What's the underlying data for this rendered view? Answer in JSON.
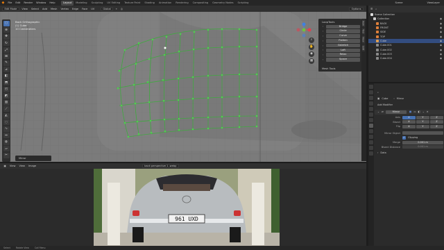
{
  "menus": [
    "File",
    "Edit",
    "Render",
    "Window",
    "Help"
  ],
  "workspaces": [
    "Layout",
    "Modeling",
    "Sculpting",
    "UV Editing",
    "Texture Paint",
    "Shading",
    "Animation",
    "Rendering",
    "Compositing",
    "Geometry Nodes",
    "Scripting"
  ],
  "active_workspace": "Layout",
  "scene_label": "Scene",
  "view_layer": "ViewLayer",
  "viewport_header": {
    "mode": "Edit Mode",
    "menus": [
      "View",
      "Select",
      "Add",
      "Mesh",
      "Vertex",
      "Edge",
      "Face",
      "UV"
    ],
    "orientation": "Global",
    "options": "Options"
  },
  "viewport_info": {
    "line1": "Back Orthographic",
    "line2": "(1) Cube",
    "line3": "10 Centimeters"
  },
  "looptools": {
    "title": "LoopTools",
    "items": [
      "Bridge",
      "Circle",
      "Curve",
      "Flatten",
      "Gstretch",
      "Loft",
      "Relax",
      "Space"
    ]
  },
  "mesh_tools": "Mesh Tools",
  "n_tabs": [
    "Item",
    "Tool",
    "View",
    "Edit"
  ],
  "last_operator": "Mirror",
  "image_editor": {
    "menus": [
      "View",
      "View",
      "Image"
    ],
    "image_name": "back perspective 1 .webp",
    "plate": "961 UXD"
  },
  "status_bar": [
    "Select",
    "Rotate View",
    "Call Menu"
  ],
  "outliner": {
    "title": "Scene Collection",
    "rows": [
      {
        "label": "Collection",
        "color": "#cccccc",
        "selected": false
      },
      {
        "label": "BACK",
        "color": "#e0803a",
        "selected": false
      },
      {
        "label": "FRONT",
        "color": "#e0803a",
        "selected": false
      },
      {
        "label": "SIDE",
        "color": "#e0803a",
        "selected": false
      },
      {
        "label": "TOP",
        "color": "#e0803a",
        "selected": false
      },
      {
        "label": "Cube",
        "color": "#e0a050",
        "selected": true
      },
      {
        "label": "Cube.001",
        "color": "#8a8a8a",
        "selected": false
      },
      {
        "label": "Cube.002",
        "color": "#8a8a8a",
        "selected": false
      },
      {
        "label": "Cube.003",
        "color": "#8a8a8a",
        "selected": false
      },
      {
        "label": "Cube.004",
        "color": "#8a8a8a",
        "selected": false
      }
    ]
  },
  "properties": {
    "object": "Cube",
    "modifier_type": "Mirror",
    "add_modifier": "Add Modifier",
    "modifier_name": "Mirror",
    "rows": [
      {
        "label": "Axis",
        "fields": [
          "X",
          "Y",
          "Z"
        ]
      },
      {
        "label": "Bisect",
        "fields": [
          "X",
          "Y",
          "Z"
        ]
      },
      {
        "label": "Flip",
        "fields": [
          "X",
          "Y",
          "Z"
        ]
      }
    ],
    "mirror_object": "Mirror Object",
    "clipping": "Clipping",
    "merge_label": "Merge",
    "merge_value": "0.001 m",
    "bisect_distance_label": "Bisect Distance",
    "bisect_distance_value": "0.001 m",
    "data_section": "Data"
  }
}
